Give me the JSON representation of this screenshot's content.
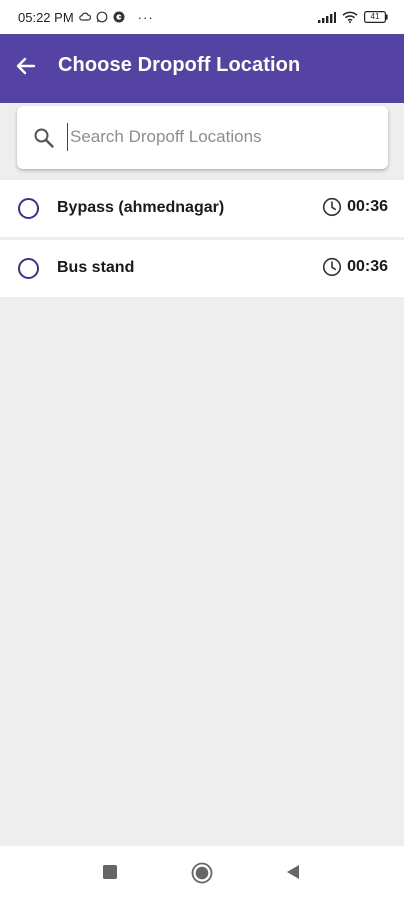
{
  "status_bar": {
    "time": "05:22 PM",
    "notification_icons": [
      "cloud-icon",
      "whatsapp-icon",
      "sync-icon"
    ],
    "more": "···",
    "battery": "41"
  },
  "app_bar": {
    "title": "Choose Dropoff Location",
    "background": "#5443a3"
  },
  "search": {
    "placeholder": "Search Dropoff Locations",
    "value": ""
  },
  "locations": [
    {
      "label": "Bypass (ahmednagar)",
      "time": "00:36",
      "selected": false
    },
    {
      "label": "Bus stand",
      "time": "00:36",
      "selected": false
    }
  ],
  "colors": {
    "accent": "#5443a3",
    "radio": "#3b3290",
    "background": "#eeeeee"
  },
  "nav_bar": {
    "buttons": [
      "recents-icon",
      "home-icon",
      "back-triangle-icon"
    ]
  }
}
